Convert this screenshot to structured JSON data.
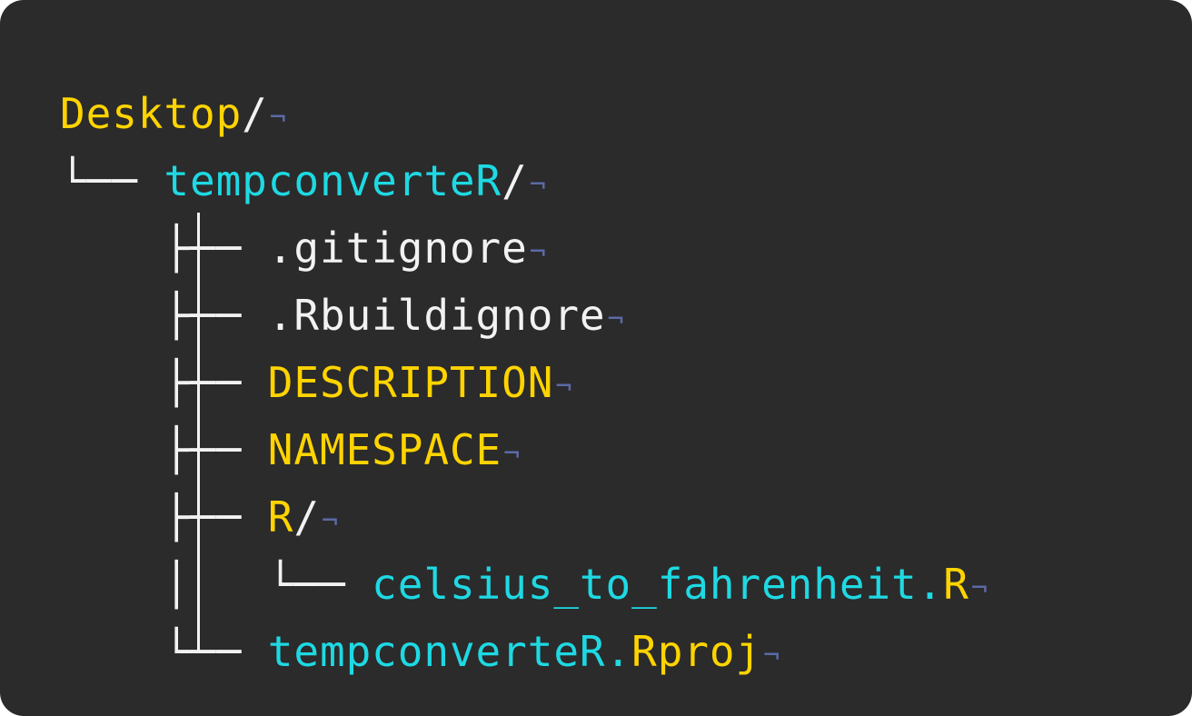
{
  "colors": {
    "background": "#2b2b2b",
    "white": "#f2f2f2",
    "yellow": "#ffd400",
    "cyan": "#1ed9e3",
    "eol_marker": "#5b6aa8"
  },
  "eol_marker": "¬",
  "tree": [
    {
      "guide": "",
      "connector": "",
      "parts": [
        {
          "text": "Desktop",
          "color": "yellow"
        },
        {
          "text": "/",
          "color": "white"
        }
      ]
    },
    {
      "guide": "",
      "connector": "└── ",
      "parts": [
        {
          "text": "tempconverteR",
          "color": "cyan"
        },
        {
          "text": "/",
          "color": "white"
        }
      ]
    },
    {
      "guide": "    ",
      "connector": "├── ",
      "parts": [
        {
          "text": ".gitignore",
          "color": "white"
        }
      ]
    },
    {
      "guide": "    ",
      "connector": "├── ",
      "parts": [
        {
          "text": ".Rbuildignore",
          "color": "white"
        }
      ]
    },
    {
      "guide": "    ",
      "connector": "├── ",
      "parts": [
        {
          "text": "DESCRIPTION",
          "color": "yellow"
        }
      ]
    },
    {
      "guide": "    ",
      "connector": "├── ",
      "parts": [
        {
          "text": "NAMESPACE",
          "color": "yellow"
        }
      ]
    },
    {
      "guide": "    ",
      "connector": "├── ",
      "parts": [
        {
          "text": "R",
          "color": "yellow"
        },
        {
          "text": "/",
          "color": "white"
        }
      ]
    },
    {
      "guide": "    │   ",
      "connector": "└── ",
      "parts": [
        {
          "text": "celsius_to_fahrenheit.",
          "color": "cyan"
        },
        {
          "text": "R",
          "color": "yellow"
        }
      ]
    },
    {
      "guide": "    ",
      "connector": "└── ",
      "parts": [
        {
          "text": "tempconverteR.",
          "color": "cyan"
        },
        {
          "text": "Rproj",
          "color": "yellow"
        }
      ]
    }
  ]
}
